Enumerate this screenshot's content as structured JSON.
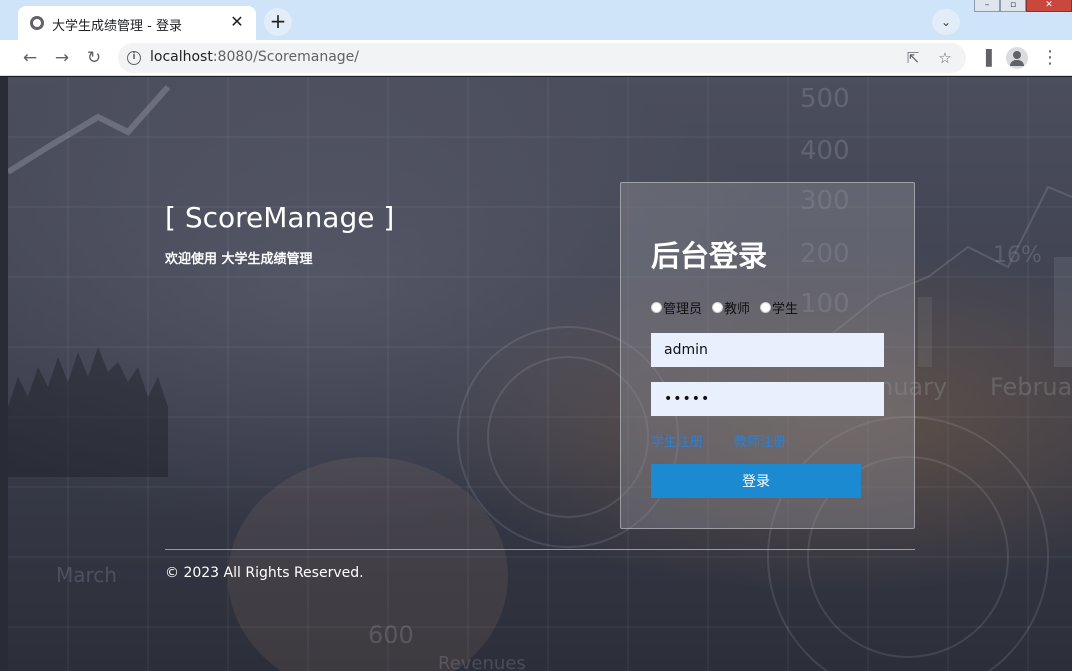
{
  "browser": {
    "tab_title": "大学生成绩管理 - 登录",
    "tab_close": "✕",
    "new_tab": "+",
    "url_host": "localhost",
    "url_path": ":8080/Scoremanage/",
    "icons": [
      "back-icon",
      "forward-icon",
      "reload-icon",
      "info-icon",
      "share-icon",
      "star-icon",
      "side-panel-icon",
      "profile-icon",
      "menu-icon"
    ]
  },
  "brand": {
    "title": "[ ScoreManage ]",
    "subtitle": "欢迎使用 大学生成绩管理"
  },
  "login": {
    "title": "后台登录",
    "roles": [
      {
        "label": "管理员",
        "selected": false
      },
      {
        "label": "教师",
        "selected": false
      },
      {
        "label": "学生",
        "selected": false
      }
    ],
    "username_value": "admin",
    "password_value": "•••••",
    "student_register_link": "学生注册",
    "teacher_register_link": "教师注册",
    "submit_label": "登录"
  },
  "footer": {
    "copyright": "© 2023 All Rights Reserved."
  },
  "colors": {
    "accent": "#1b8ad1",
    "link": "#2f7fd0",
    "input_bg": "#e8f0fe"
  }
}
